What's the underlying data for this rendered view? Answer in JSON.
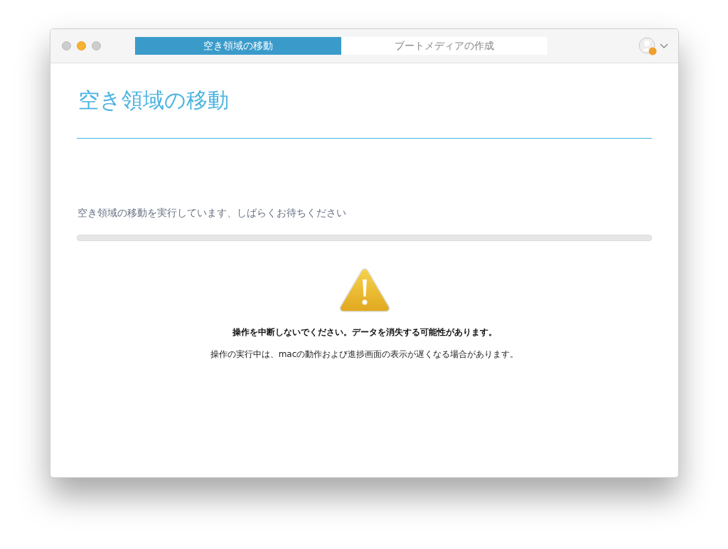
{
  "tabs": [
    {
      "label": "空き領域の移動",
      "selected": true
    },
    {
      "label": "ブートメディアの作成",
      "selected": false
    }
  ],
  "heading": "空き領域の移動",
  "progress": {
    "message": "空き領域の移動を実行しています、しばらくお待ちください",
    "level": 0
  },
  "warning": {
    "title": "操作を中断しないでください。データを消失する可能性があります。",
    "note": "操作の実行中は、macの動作および進捗画面の表示が遅くなる場合があります。"
  }
}
